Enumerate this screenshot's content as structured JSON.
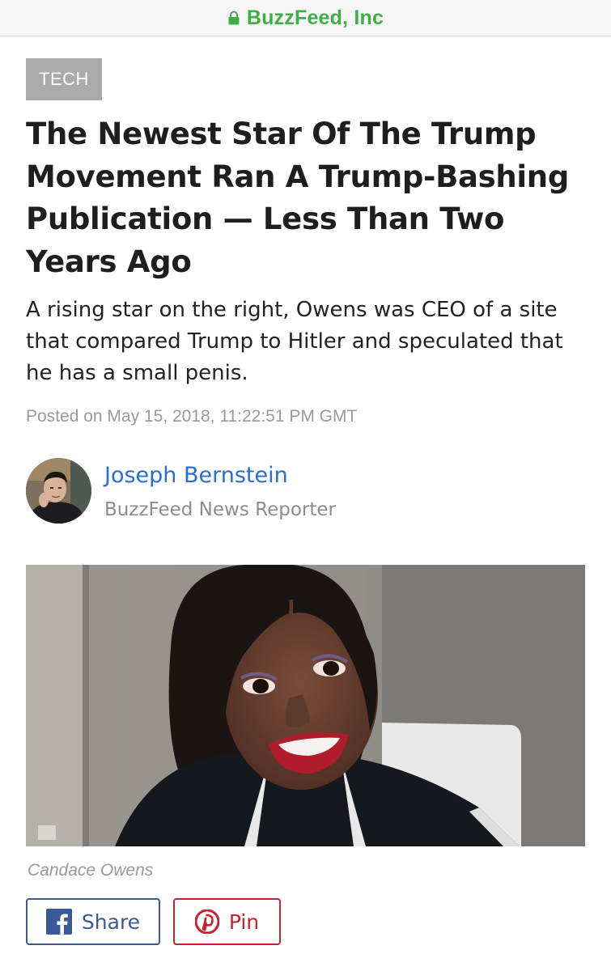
{
  "browser": {
    "site_name": "BuzzFeed, Inc",
    "icon": "lock-icon",
    "accent": "#3fae49"
  },
  "article": {
    "category": "TECH",
    "headline": "The Newest Star Of The Trump Movement Ran A Trump-Bashing Publication — Less Than Two Years Ago",
    "dek": "A rising star on the right, Owens was CEO of a site that compared Trump to Hitler and speculated that he has a small penis.",
    "timestamp": "Posted on May 15, 2018, 11:22:51 PM GMT",
    "author": {
      "name": "Joseph Bernstein",
      "title": "BuzzFeed News Reporter",
      "name_color": "#2a6dd6"
    },
    "image_caption": "Candace Owens"
  },
  "share": {
    "facebook_label": "Share",
    "facebook_icon": "facebook-icon",
    "facebook_color": "#3b5998",
    "pinterest_label": "Pin",
    "pinterest_icon": "pinterest-icon",
    "pinterest_color": "#c8232c"
  }
}
